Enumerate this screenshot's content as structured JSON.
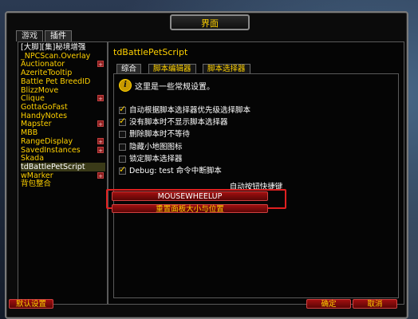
{
  "window": {
    "title": "界面"
  },
  "category_tabs": [
    {
      "label": "游戏"
    },
    {
      "label": "插件"
    }
  ],
  "addons": [
    {
      "label": "[大脚][集]秘境增强",
      "expandable": false
    },
    {
      "label": "_NPCScan.Overlay",
      "expandable": false
    },
    {
      "label": "Auctionator",
      "expandable": true
    },
    {
      "label": "AzeriteTooltip",
      "expandable": false
    },
    {
      "label": "Battle Pet BreedID",
      "expandable": false
    },
    {
      "label": "BlizzMove",
      "expandable": false
    },
    {
      "label": "Clique",
      "expandable": true
    },
    {
      "label": "GottaGoFast",
      "expandable": false
    },
    {
      "label": "HandyNotes",
      "expandable": false
    },
    {
      "label": "Mapster",
      "expandable": true
    },
    {
      "label": "MBB",
      "expandable": false
    },
    {
      "label": "RangeDisplay",
      "expandable": true
    },
    {
      "label": "SavedInstances",
      "expandable": true
    },
    {
      "label": "Skada",
      "expandable": false
    },
    {
      "label": "tdBattlePetScript",
      "expandable": false,
      "selected": true
    },
    {
      "label": "wMarker",
      "expandable": true
    },
    {
      "label": "背包整合",
      "expandable": false
    }
  ],
  "panel": {
    "addon_title": "tdBattlePetScript",
    "sub_tabs": [
      {
        "label": "综合"
      },
      {
        "label": "脚本编辑器"
      },
      {
        "label": "脚本选择器"
      }
    ],
    "info_text": "这里是一些常规设置。",
    "options": [
      {
        "label": "自动根据脚本选择器优先级选择脚本",
        "checked": true
      },
      {
        "label": "没有脚本时不显示脚本选择器",
        "checked": true
      },
      {
        "label": "删除脚本时不等待",
        "checked": false
      },
      {
        "label": "隐藏小地图图标",
        "checked": false
      },
      {
        "label": "锁定脚本选择器",
        "checked": false
      },
      {
        "label": "Debug: test 命令中断脚本",
        "checked": true
      }
    ],
    "hotkey_label": "自动按钮快捷键",
    "hotkey_value": "MOUSEWHEELUP",
    "reset_position_label": "重置面板大小与位置"
  },
  "footer": {
    "defaults_label": "默认设置",
    "ok_label": "确定",
    "cancel_label": "取消"
  },
  "colors": {
    "accent_gold": "#ffd100",
    "button_red": "#a01010",
    "highlight_red": "#e02020"
  }
}
